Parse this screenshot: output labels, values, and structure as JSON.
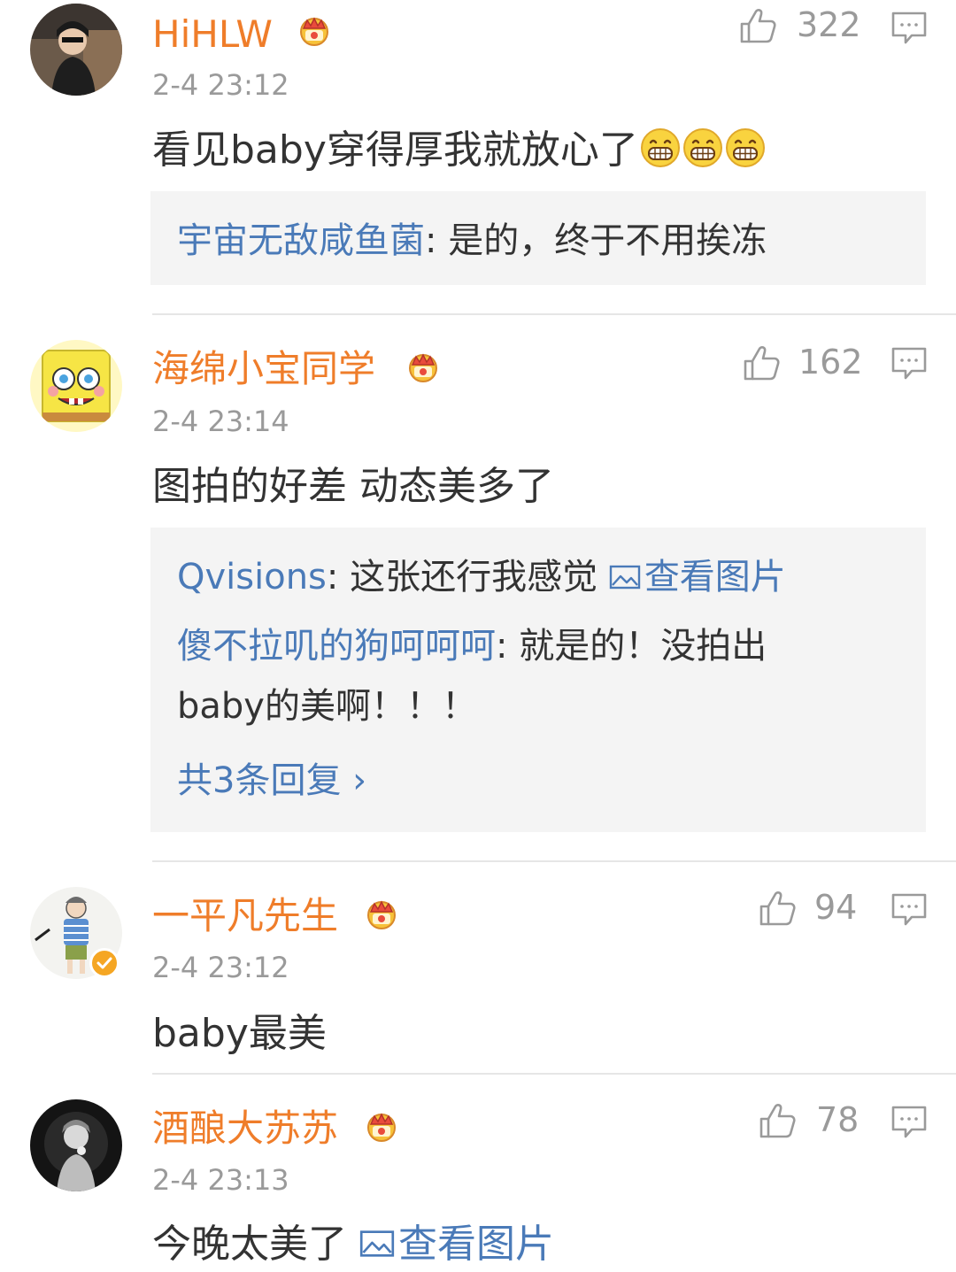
{
  "colors": {
    "username": "#ef7d2a",
    "link": "#4a7ab8",
    "meta": "#9a9a9a",
    "text": "#333333",
    "reply_bg": "#f4f4f4",
    "divider": "#e6e6e6"
  },
  "comments": [
    {
      "username": "HiHLW",
      "timestamp": "2-4 23:12",
      "likes": "322",
      "content": "看见baby穿得厚我就放心了",
      "emoji_count": 3,
      "replies": [
        {
          "user": "宇宙无敌咸鱼菌",
          "sep": ": ",
          "text": "是的，终于不用挨冻"
        }
      ]
    },
    {
      "username": "海绵小宝同学",
      "timestamp": "2-4 23:14",
      "likes": "162",
      "content": "图拍的好差 动态美多了",
      "replies": [
        {
          "user": "Qvisions",
          "sep": ": ",
          "text": "这张还行我感觉 ",
          "link": "查看图片"
        },
        {
          "user": "傻不拉叽的狗呵呵呵",
          "sep": ": ",
          "text": "就是的！没拍出",
          "text2": "baby的美啊！！！"
        }
      ],
      "more_replies": "共3条回复 ›"
    },
    {
      "username": "一平凡先生",
      "timestamp": "2-4 23:12",
      "likes": "94",
      "content": "baby最美"
    },
    {
      "username": "酒酿大苏苏",
      "timestamp": "2-4 23:13",
      "likes": "78",
      "content": "今晚太美了 ",
      "link": "查看图片"
    }
  ]
}
